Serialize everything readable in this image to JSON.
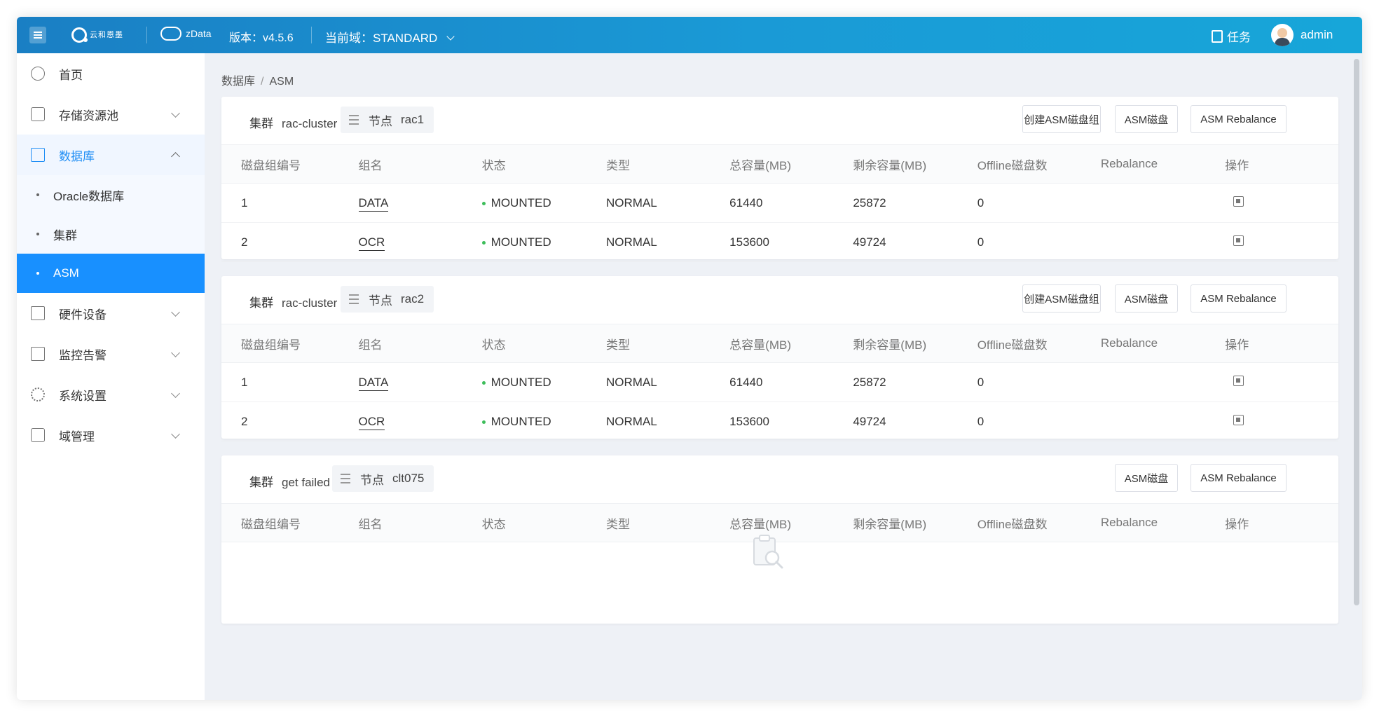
{
  "topbar": {
    "brand_text": "云和恩墨",
    "product": "zData",
    "version": "版本：v4.5.6",
    "domain": "当前域：STANDARD",
    "tasks": "任务",
    "user": "admin"
  },
  "breadcrumb": {
    "parent": "数据库",
    "sep": "/",
    "current": "ASM"
  },
  "sidebar": {
    "home": "首页",
    "storage": "存储资源池",
    "database": "数据库",
    "oracle": "Oracle数据库",
    "cluster": "集群",
    "asm": "ASM",
    "hardware": "硬件设备",
    "monitor": "监控告警",
    "settings": "系统设置",
    "domain_mgmt": "域管理"
  },
  "labels": {
    "cluster": "集群",
    "node": "节点",
    "btn_create": "创建ASM磁盘组",
    "btn_disk": "ASM磁盘",
    "btn_rebalance": "ASM Rebalance"
  },
  "columns": [
    "磁盘组编号",
    "组名",
    "状态",
    "类型",
    "总容量(MB)",
    "剩余容量(MB)",
    "Offline磁盘数",
    "Rebalance",
    "操作"
  ],
  "cards": [
    {
      "cluster": "rac-cluster",
      "node": "rac1",
      "rows": [
        {
          "id": "1",
          "name": "DATA",
          "status": "MOUNTED",
          "type": "NORMAL",
          "total": "61440",
          "free": "25872",
          "offline": "0",
          "rebalance": ""
        },
        {
          "id": "2",
          "name": "OCR",
          "status": "MOUNTED",
          "type": "NORMAL",
          "total": "153600",
          "free": "49724",
          "offline": "0",
          "rebalance": ""
        }
      ]
    },
    {
      "cluster": "rac-cluster",
      "node": "rac2",
      "rows": [
        {
          "id": "1",
          "name": "DATA",
          "status": "MOUNTED",
          "type": "NORMAL",
          "total": "61440",
          "free": "25872",
          "offline": "0",
          "rebalance": ""
        },
        {
          "id": "2",
          "name": "OCR",
          "status": "MOUNTED",
          "type": "NORMAL",
          "total": "153600",
          "free": "49724",
          "offline": "0",
          "rebalance": ""
        }
      ]
    },
    {
      "cluster": "get failed",
      "node": "clt075",
      "rows": []
    }
  ],
  "colors": {
    "accent": "#1890ff",
    "status_ok": "#3dbd5a",
    "topbar": "#1a8fd0"
  }
}
